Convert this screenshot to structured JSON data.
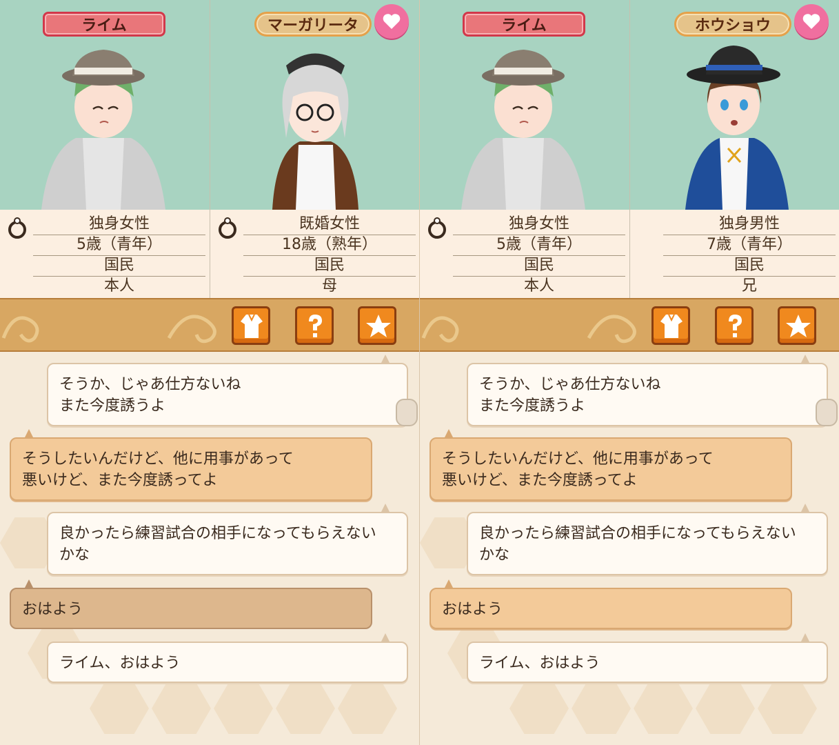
{
  "left": {
    "player": {
      "name": "ライム",
      "info": [
        "独身女性",
        "5歳（青年）",
        "国民",
        "本人"
      ]
    },
    "partner": {
      "name": "マーガリータ",
      "info": [
        "既婚女性",
        "18歳（熟年）",
        "国民",
        "母"
      ]
    },
    "messages": [
      {
        "speaker": "partner",
        "line1": "そうか、じゃあ仕方ないね",
        "line2": "また今度誘うよ"
      },
      {
        "speaker": "player",
        "line1": "そうしたいんだけど、他に用事があって",
        "line2": "悪いけど、また今度誘ってよ"
      },
      {
        "speaker": "partner",
        "line1": "良かったら練習試合の相手になってもらえない",
        "line2": "かな"
      },
      {
        "speaker": "player",
        "line1": "おはよう",
        "line2": ""
      },
      {
        "speaker": "partner",
        "line1": "ライム、おはよう",
        "line2": ""
      }
    ]
  },
  "right": {
    "player": {
      "name": "ライム",
      "info": [
        "独身女性",
        "5歳（青年）",
        "国民",
        "本人"
      ]
    },
    "partner": {
      "name": "ホウショウ",
      "info": [
        "独身男性",
        "7歳（青年）",
        "国民",
        "兄"
      ]
    },
    "messages": [
      {
        "speaker": "partner",
        "line1": "そうか、じゃあ仕方ないね",
        "line2": "また今度誘うよ"
      },
      {
        "speaker": "player",
        "line1": "そうしたいんだけど、他に用事があって",
        "line2": "悪いけど、また今度誘ってよ"
      },
      {
        "speaker": "partner",
        "line1": "良かったら練習試合の相手になってもらえない",
        "line2": "かな"
      },
      {
        "speaker": "player",
        "line1": "おはよう",
        "line2": ""
      },
      {
        "speaker": "partner",
        "line1": "ライム、おはよう",
        "line2": ""
      }
    ]
  },
  "icons": [
    "heart-icon",
    "ring-icon",
    "outfit-icon",
    "question-icon",
    "star-icon"
  ],
  "colors": {
    "panel_bg": "#a8d3c1",
    "toolbar": "#d8a762",
    "button": "#f0891e",
    "heart": "#f06f9f",
    "name_red": "#e9767a"
  }
}
